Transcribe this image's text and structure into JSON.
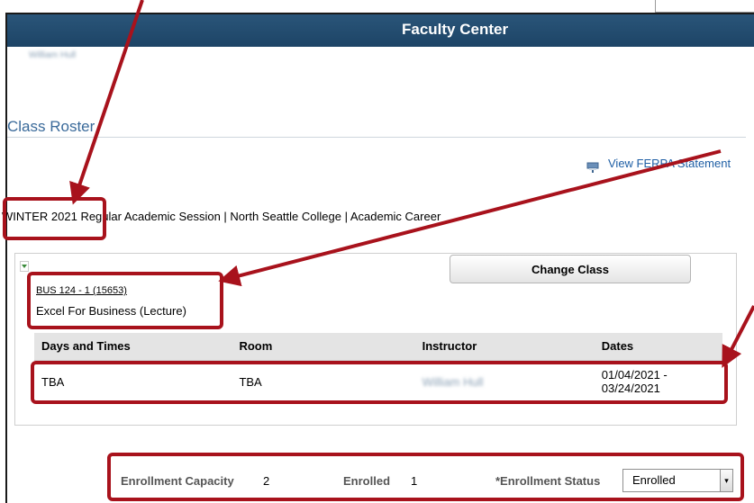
{
  "header": {
    "title": "Faculty Center"
  },
  "user": {
    "name": "William Hull"
  },
  "page": {
    "section_title": "Class Roster",
    "ferpa_link": "View FERPA Statement",
    "term": "WINTER 2021",
    "term_details": "Regular Academic Session | North Seattle College | Academic Career"
  },
  "class_info": {
    "code": "BUS 124 - 1 (15653)",
    "description": "Excel For Business (Lecture)",
    "change_button": "Change Class"
  },
  "meeting_table": {
    "headers": [
      "Days and Times",
      "Room",
      "Instructor",
      "Dates"
    ],
    "rows": [
      {
        "days_times": "TBA",
        "room": "TBA",
        "instructor": "William Hull",
        "dates": "01/04/2021 - 03/24/2021"
      }
    ]
  },
  "enrollment": {
    "capacity_label": "Enrollment Capacity",
    "capacity_value": "2",
    "enrolled_label": "Enrolled",
    "enrolled_value": "1",
    "status_label": "*Enrollment Status",
    "status_value": "Enrolled"
  },
  "colors": {
    "header_bg": "#1d4466",
    "title": "#3a6a9a",
    "link": "#1f5fa5",
    "annotation": "#a8121c"
  }
}
